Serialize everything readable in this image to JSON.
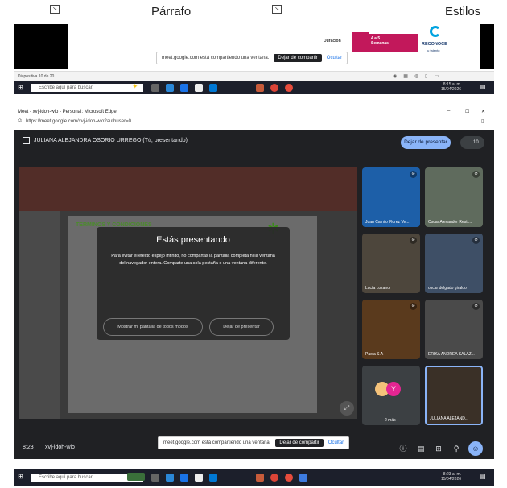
{
  "ribbon": {
    "paragraph": "Párrafo",
    "styles": "Estilos",
    "launcher_glyph": "↘"
  },
  "prev_screen": {
    "promo_duration": "Duración",
    "promo_weeks": "4 a 5\nSemanas",
    "promo_brand": "RECONOCE",
    "promo_brand_sub": "tu talento",
    "share_text": "meet.google.com está compartiendo una ventana.",
    "share_stop": "Dejar de compartir",
    "share_hide": "Ocultar",
    "slide_status": "Diapositiva 10 de 20",
    "clock_time": "8:15 a. m.",
    "clock_date": "15/04/2026"
  },
  "taskbar": {
    "search_placeholder": "Escribe aquí para buscar.",
    "search_icon": "magnifier-icon",
    "start_icon": "windows-start-icon"
  },
  "edge": {
    "title": "Meet - xvj-idoh-wio - Personal: Microsoft Edge",
    "url": "https://meet.google.com/xvj-idoh-wio?authuser=0",
    "minimize": "–",
    "maximize": "☐",
    "close": "✕"
  },
  "meet": {
    "presenter_label": "JULIANA ALEJANDRA OSORIO URREGO (Tú, presentando)",
    "stop_presenting_top": "Dejar de presentar",
    "participant_count": "10",
    "overlay": {
      "title": "Estás presentando",
      "body": "Para evitar el efecto espejo infinito, no compartas la pantalla completa ni la ventana del navegador entera. Comparte una sola pestaña o una ventana diferente.",
      "show_anyway": "Mostrar mi pantalla de todos modos",
      "stop": "Dejar de presentar"
    },
    "slide_heading": "TERMINOS Y CONDICIONES",
    "participants": [
      {
        "name": "Juan Camilo Florez Ve...",
        "bg": "#1d5fa8"
      },
      {
        "name": "Oscar Alexander Restr...",
        "bg": "#5f6b5d"
      },
      {
        "name": "Lucía Lozano",
        "bg": "#4d463c"
      },
      {
        "name": "oscar delgado giraldo",
        "bg": "#3e4f66"
      },
      {
        "name": "Paola S.A",
        "bg": "#5a3a1d"
      },
      {
        "name": "ERIKA ANDREA SALAZ...",
        "bg": "#4a4a4a"
      },
      {
        "name": "2 más",
        "bg": "#3c4043"
      },
      {
        "name": "JULIANA ALEJAND...",
        "bg": "#3a3027"
      }
    ],
    "avatar_letter": "Y",
    "bottom": {
      "time": "8:23",
      "meeting_code": "xvj-idoh-wio"
    }
  },
  "bottom_share": {
    "text": "meet.google.com está compartiendo una ventana.",
    "stop": "Dejar de compartir",
    "hide": "Ocultar"
  },
  "bottom_clock": {
    "time": "8:23 a. m.",
    "date": "15/04/2026"
  },
  "colors": {
    "meet_bg": "#202124",
    "accent_blue": "#8ab4f8",
    "taskbar_bg": "#1c1f2b"
  }
}
